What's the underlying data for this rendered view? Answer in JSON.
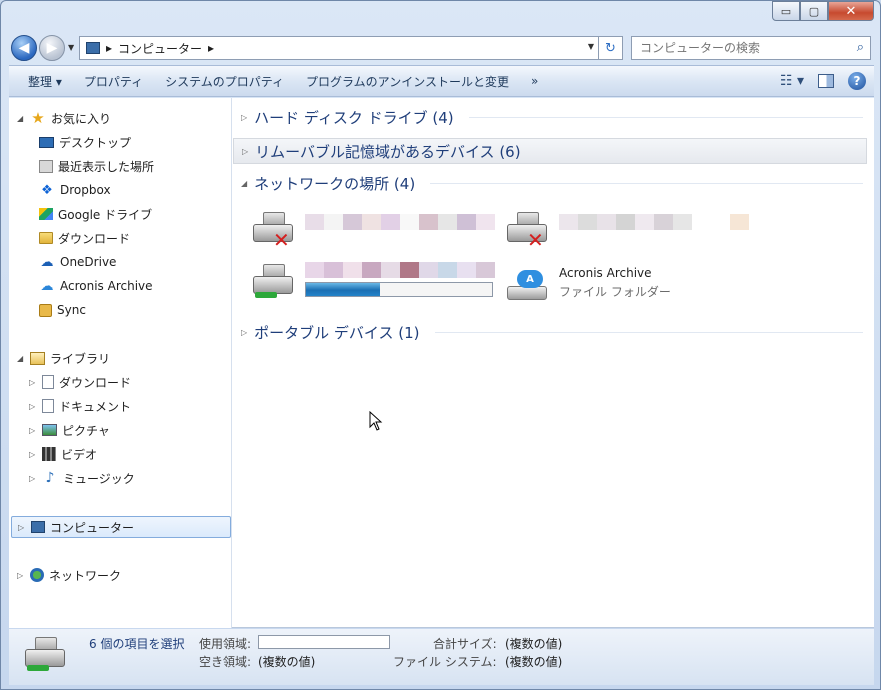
{
  "window": {
    "min_label": "▭",
    "max_label": "▢",
    "close_label": "✕"
  },
  "address": {
    "path_root": "▸",
    "path_item": "コンピューター",
    "path_after": "▸",
    "search_placeholder": "コンピューターの検索"
  },
  "toolbar": {
    "organize": "整理 ▾",
    "properties": "プロパティ",
    "system_properties": "システムのプロパティ",
    "uninstall": "プログラムのアンインストールと変更",
    "more": "»",
    "help": "?"
  },
  "sidebar": {
    "favorites": "お気に入り",
    "favorites_items": [
      "デスクトップ",
      "最近表示した場所",
      "Dropbox",
      "Google ドライブ",
      "ダウンロード",
      "OneDrive",
      "Acronis Archive",
      "Sync"
    ],
    "libraries": "ライブラリ",
    "library_items": [
      "ダウンロード",
      "ドキュメント",
      "ピクチャ",
      "ビデオ",
      "ミュージック"
    ],
    "computer": "コンピューター",
    "network": "ネットワーク"
  },
  "content": {
    "groups": [
      "ハード ディスク ドライブ (4)",
      "リムーバブル記憶域があるデバイス (6)",
      "ネットワークの場所 (4)",
      "ポータブル デバイス (1)"
    ],
    "acronis_name": "Acronis Archive",
    "acronis_type": "ファイル フォルダー",
    "progress_fraction": 0.4
  },
  "status": {
    "selected": "6 個の項目を選択",
    "used_label": "使用領域:",
    "free_label": "空き領域:",
    "free_value": "(複数の値)",
    "total_label": "合計サイズ:",
    "total_value": "(複数の値)",
    "fs_label": "ファイル システム:",
    "fs_value": "(複数の値)"
  }
}
